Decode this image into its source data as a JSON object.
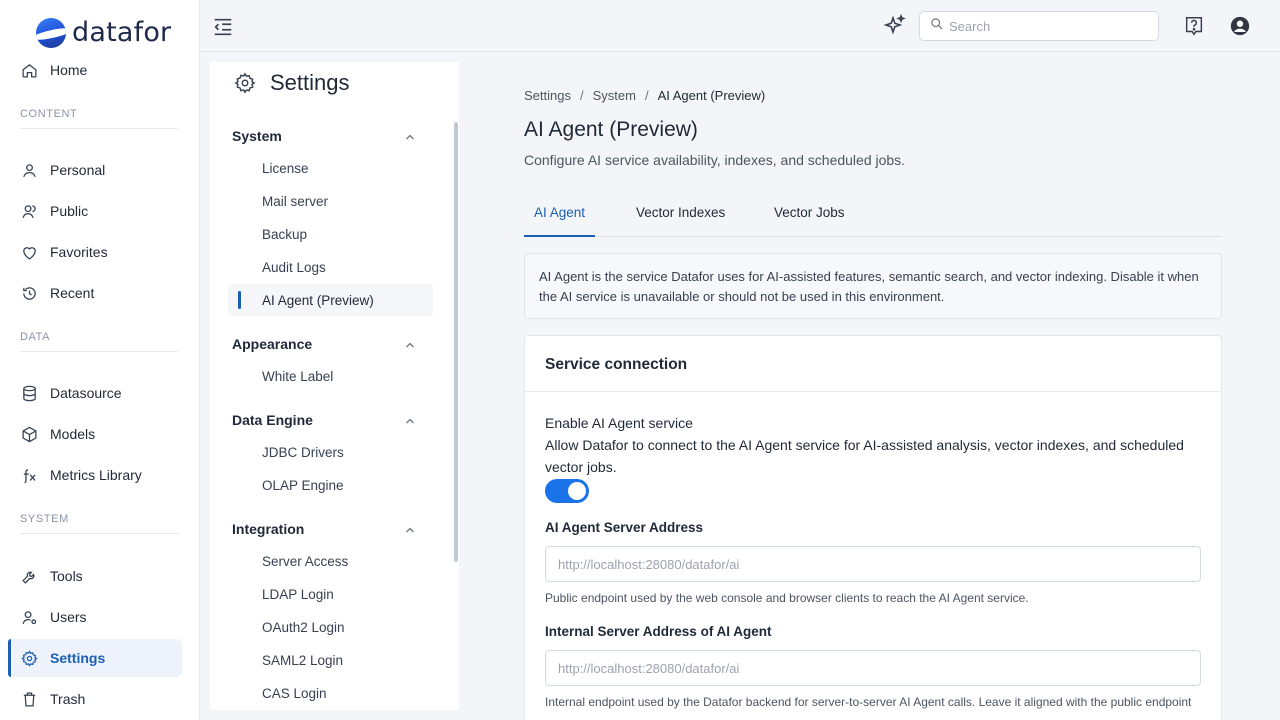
{
  "brand": {
    "name": "datafor"
  },
  "leftnav": {
    "home": "Home",
    "sections": {
      "content": "CONTENT",
      "data": "DATA",
      "system": "SYSTEM"
    },
    "items": {
      "personal": "Personal",
      "public": "Public",
      "favorites": "Favorites",
      "recent": "Recent",
      "datasource": "Datasource",
      "models": "Models",
      "metrics": "Metrics Library",
      "tools": "Tools",
      "users": "Users",
      "settings": "Settings",
      "trash": "Trash"
    },
    "active": "settings"
  },
  "topbar": {
    "search_placeholder": "Search"
  },
  "settings_panel": {
    "title": "Settings",
    "groups": {
      "system": {
        "label": "System",
        "items": [
          "License",
          "Mail server",
          "Backup",
          "Audit Logs",
          "AI Agent (Preview)"
        ]
      },
      "appearance": {
        "label": "Appearance",
        "items": [
          "White Label"
        ]
      },
      "data_engine": {
        "label": "Data Engine",
        "items": [
          "JDBC Drivers",
          "OLAP Engine"
        ]
      },
      "integration": {
        "label": "Integration",
        "items": [
          "Server Access",
          "LDAP Login",
          "OAuth2 Login",
          "SAML2 Login",
          "CAS Login"
        ]
      }
    },
    "active_item": "AI Agent (Preview)"
  },
  "main": {
    "breadcrumb": [
      "Settings",
      "System",
      "AI Agent (Preview)"
    ],
    "breadcrumb_sep": "/",
    "title": "AI Agent (Preview)",
    "description": "Configure AI service availability, indexes, and scheduled jobs.",
    "tabs": [
      "AI Agent",
      "Vector Indexes",
      "Vector Jobs"
    ],
    "active_tab": "AI Agent",
    "info": "AI Agent is the service Datafor uses for AI-assisted features, semantic search, and vector indexing. Disable it when the AI service is unavailable or should not be used in this environment.",
    "card": {
      "title": "Service connection",
      "enable_label": "Enable AI Agent service",
      "enable_desc": "Allow Datafor to connect to the AI Agent service for AI-assisted analysis, vector indexes, and scheduled vector jobs.",
      "enabled": true,
      "server_label": "AI Agent Server Address",
      "server_placeholder": "http://localhost:28080/datafor/ai",
      "server_help": "Public endpoint used by the web console and browser clients to reach the AI Agent service.",
      "internal_label": "Internal Server Address of AI Agent",
      "internal_placeholder": "http://localhost:28080/datafor/ai",
      "internal_help": "Internal endpoint used by the Datafor backend for server-to-server AI Agent calls. Leave it aligned with the public endpoint"
    }
  }
}
